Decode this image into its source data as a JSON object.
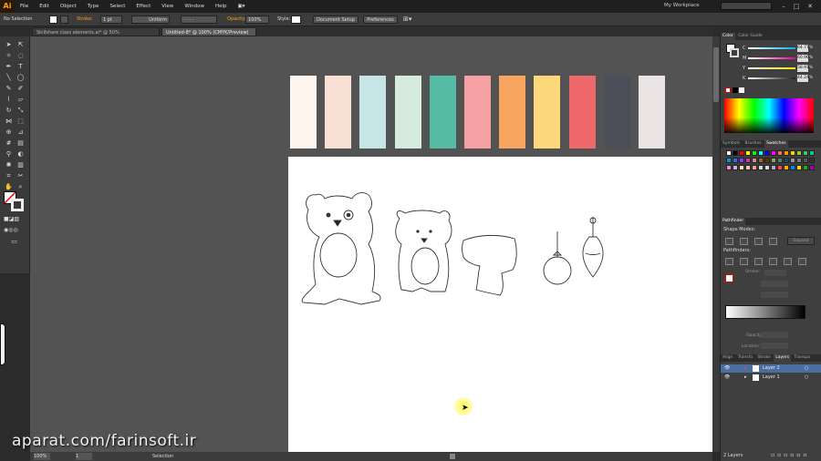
{
  "app": {
    "logo": "Ai",
    "workspace": "My Workplace",
    "search_placeholder": ""
  },
  "menu": [
    "File",
    "Edit",
    "Object",
    "Type",
    "Select",
    "Effect",
    "View",
    "Window",
    "Help"
  ],
  "control_bar": {
    "selection_label": "No Selection",
    "stroke_label": "Stroke:",
    "stroke_weight": "1 pt",
    "stroke_profile": "Uniform",
    "opacity_label": "Opacity:",
    "opacity_value": "100%",
    "style_label": "Style:",
    "document_setup": "Document Setup",
    "preferences": "Preferences"
  },
  "tabs": [
    {
      "label": "Skillshare class elements.ai* @ 50% (CMYK/Preview)",
      "active": false
    },
    {
      "label": "Untitled-8* @ 100% (CMYK/Preview)",
      "active": true
    }
  ],
  "palette_colors": [
    "#fdf5ee",
    "#f9e0d5",
    "#c7e4e6",
    "#d7ebdc",
    "#55bba4",
    "#f5a1a4",
    "#f9a560",
    "#fcd87a",
    "#ef686c",
    "#4c4f59",
    "#ebe4e4"
  ],
  "color_panel": {
    "tabs": [
      "Color",
      "Color Guide"
    ],
    "channels": [
      {
        "label": "C",
        "value": "64.77",
        "unit": "%",
        "color": "#00aeef"
      },
      {
        "label": "M",
        "value": "60.96",
        "unit": "%",
        "color": "#ec008c"
      },
      {
        "label": "Y",
        "value": "58.91",
        "unit": "%",
        "color": "#fff200"
      },
      {
        "label": "K",
        "value": "44.24",
        "unit": "%",
        "color": "#222222"
      }
    ]
  },
  "swatches_panel": {
    "tabs": [
      "Symbols",
      "Brushes",
      "Swatches"
    ]
  },
  "pathfinder": {
    "tabs": [
      "Pathfinder"
    ],
    "shape_modes_label": "Shape Modes:",
    "expand_label": "Expand",
    "pathfinders_label": "Pathfinders:"
  },
  "appearance": {
    "stroke_label": "Stroke:",
    "opacity_label": "Opacity:",
    "location_label": "Location:"
  },
  "bottom_tabs": [
    "Align",
    "Transfo",
    "Stroke",
    "Layers",
    "Transpa"
  ],
  "layers": [
    {
      "name": "Layer 2",
      "selected": true
    },
    {
      "name": "Layer 1",
      "selected": false
    }
  ],
  "layers_count": "2 Layers",
  "status": {
    "zoom": "100%",
    "page": "1",
    "tool": "Selection"
  },
  "watermark": "aparat.com/farinsoft.ir"
}
